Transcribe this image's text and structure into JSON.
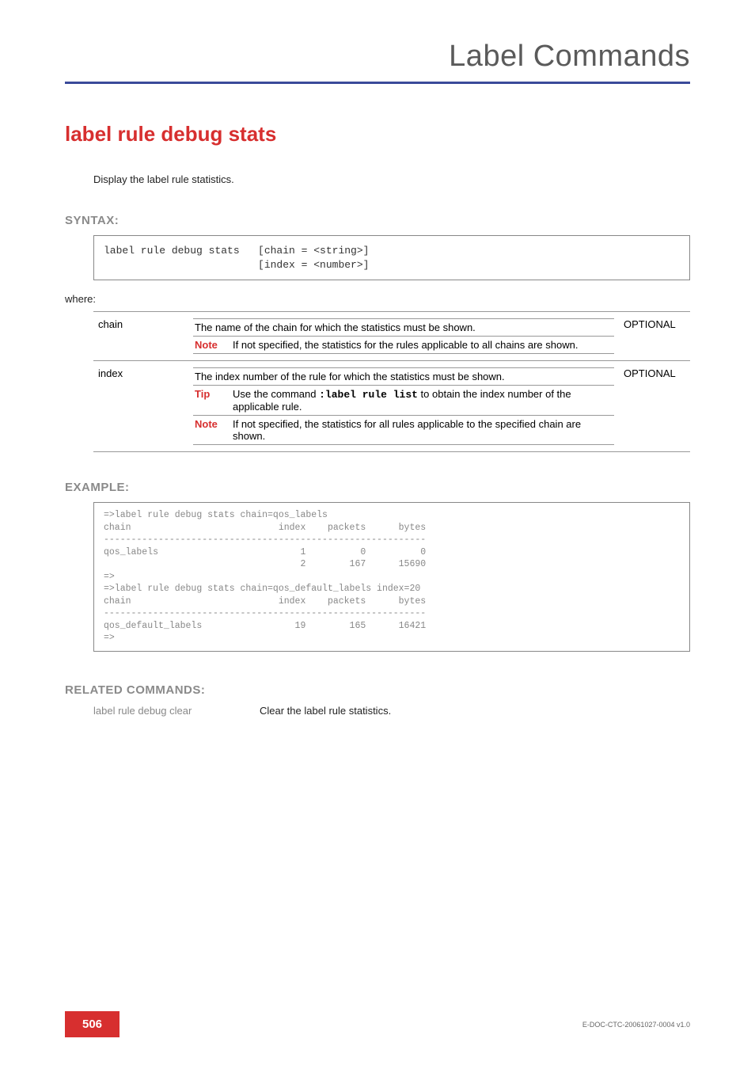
{
  "header": {
    "title": "Label Commands"
  },
  "command": {
    "title": "label rule debug stats",
    "description": "Display the label rule statistics."
  },
  "syntax": {
    "heading": "SYNTAX:",
    "text": "label rule debug stats   [chain = <string>]\n                         [index = <number>]",
    "where": "where:"
  },
  "params": {
    "chain": {
      "name": "chain",
      "desc": "The name of the chain for which the statistics must be shown.",
      "optional": "OPTIONAL",
      "note_label": "Note",
      "note_text": "If not specified, the statistics for the rules applicable to all chains are shown."
    },
    "index": {
      "name": "index",
      "desc": "The index number of the rule for which the statistics must be shown.",
      "optional": "OPTIONAL",
      "tip_label": "Tip",
      "tip_pre": "Use the command ",
      "tip_cmd": ":label rule list",
      "tip_post": " to obtain the index number of the applicable rule.",
      "note_label": "Note",
      "note_text": "If not specified, the statistics for all rules applicable to the specified chain are shown."
    }
  },
  "example": {
    "heading": "EXAMPLE:",
    "text": "=>label rule debug stats chain=qos_labels\nchain                           index    packets      bytes\n-----------------------------------------------------------\nqos_labels                          1          0          0\n                                    2        167      15690\n=>\n=>label rule debug stats chain=qos_default_labels index=20\nchain                           index    packets      bytes\n-----------------------------------------------------------\nqos_default_labels                 19        165      16421\n=>"
  },
  "chart_data": [
    {
      "type": "table",
      "title": "label rule debug stats chain=qos_labels",
      "columns": [
        "chain",
        "index",
        "packets",
        "bytes"
      ],
      "rows": [
        [
          "qos_labels",
          1,
          0,
          0
        ],
        [
          "",
          2,
          167,
          15690
        ]
      ]
    },
    {
      "type": "table",
      "title": "label rule debug stats chain=qos_default_labels index=20",
      "columns": [
        "chain",
        "index",
        "packets",
        "bytes"
      ],
      "rows": [
        [
          "qos_default_labels",
          19,
          165,
          16421
        ]
      ]
    }
  ],
  "related": {
    "heading": "RELATED COMMANDS:",
    "cmd": "label rule debug clear",
    "desc": "Clear the label rule statistics."
  },
  "footer": {
    "page": "506",
    "docid": "E-DOC-CTC-20061027-0004 v1.0"
  }
}
